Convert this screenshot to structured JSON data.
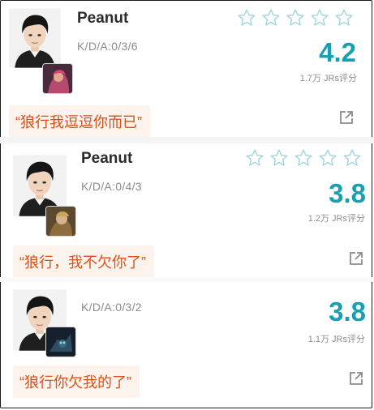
{
  "accent_color": "#1a9fb0",
  "quote_color": "#d9501b",
  "rating_max": 5,
  "score_suffix": "JRs评分",
  "cards": [
    {
      "player_name": "Peanut",
      "kda": "K/D/A:0/3/6",
      "score": "4.2",
      "rating_count": "1.7万 JRs评分",
      "comment": "“狼行我逗逗你而已”",
      "champion_icon": "vi-champion-icon",
      "share_icon": "share-icon"
    },
    {
      "player_name": "Peanut",
      "kda": "K/D/A:0/4/3",
      "score": "3.8",
      "rating_count": "1.2万 JRs评分",
      "comment": "“狼行，我不欠你了”",
      "champion_icon": "xin-zhao-champion-icon",
      "share_icon": "share-icon"
    },
    {
      "player_name": "",
      "kda": "K/D/A:0/3/2",
      "score": "3.8",
      "rating_count": "1.1万 JRs评分",
      "comment": "“狼行你欠我的了”",
      "champion_icon": "kha-zix-champion-icon",
      "share_icon": "share-icon"
    }
  ]
}
